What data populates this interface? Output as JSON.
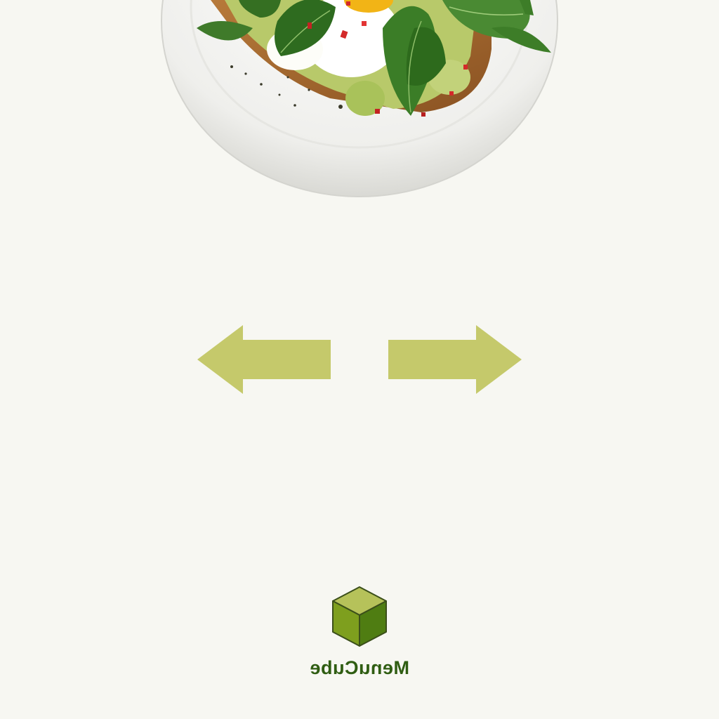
{
  "hero": {
    "image_icon": "avocado-toast-plate-image"
  },
  "navigation": {
    "prev_icon": "arrow-left-icon",
    "next_icon": "arrow-right-icon"
  },
  "brand": {
    "logo_icon": "cube-icon",
    "name": "MenuCube"
  },
  "colors": {
    "background": "#f7f7f2",
    "arrow": "#c5c96b",
    "cube_top": "#b6c25a",
    "cube_left": "#7e9f1e",
    "cube_right": "#4f7d12",
    "brand_text": "#2f5d12"
  }
}
